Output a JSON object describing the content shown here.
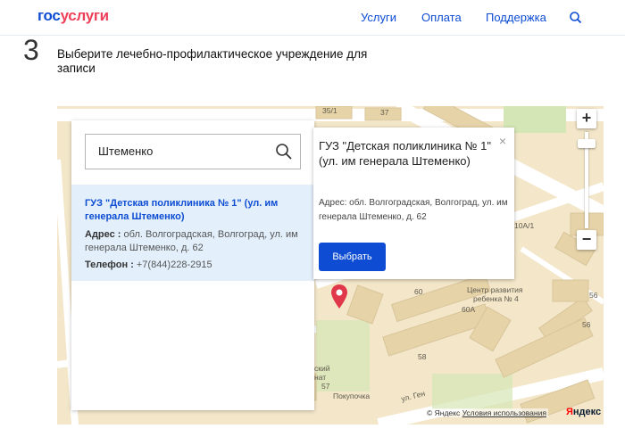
{
  "header": {
    "logo_part1": "гос",
    "logo_part2": "услуги",
    "nav": [
      "Услуги",
      "Оплата",
      "Поддержка"
    ]
  },
  "step": {
    "number": "3",
    "title": "Выберите лечебно-профилактическое учреждение для записи"
  },
  "search": {
    "value": "Штеменко"
  },
  "result": {
    "name": "ГУЗ \"Детская поликлиника № 1\" (ул. им генерала Штеменко)",
    "address_label": "Адрес :",
    "address_value": " обл. Волгоградская, Волгоград, ул. им генерала Штеменко, д. 62",
    "phone_label": "Телефон :",
    "phone_value": " +7(844)228-2915"
  },
  "balloon": {
    "title": "ГУЗ \"Детская поликлиника № 1\" (ул. им генерала Штеменко)",
    "address": "Адрес: обл. Волгоградская, Волгоград, ул. им генерала Штеменко, д. 62",
    "button": "Выбрать",
    "close": "×"
  },
  "map": {
    "labels": [
      "35/1",
      "37",
      "60",
      "60A",
      "58",
      "56",
      "56",
      "57",
      "10А/1",
      "Центр развития",
      "ребенка № 4",
      "Покупочка",
      "ский",
      "нат",
      "ул. Ген"
    ],
    "copyright_prefix": "© Яндекс",
    "terms": "Условия использования",
    "yandex_logo_y": "Я",
    "yandex_logo_rest": "ндекс",
    "zoom_in": "+",
    "zoom_out": "−"
  },
  "colors": {
    "brand_blue": "#0d4cd3",
    "brand_red": "#ee3f58",
    "result_bg": "#e3f0fb",
    "map_bg": "#f3e6c9",
    "marker": "#e0384a"
  }
}
